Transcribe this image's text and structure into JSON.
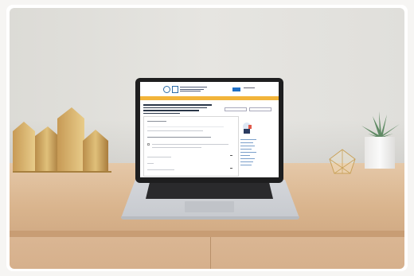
{
  "screen": {
    "site_title": "",
    "lang_button": "",
    "login_link": "",
    "banner_text": "",
    "page_title": "",
    "buttons": [
      "",
      ""
    ]
  },
  "colors": {
    "accent_blue": "#1f6fc6",
    "banner_yellow": "#f2b43a",
    "wall": "#e2e1dd",
    "desk_wood": "#d9b48d",
    "gold": "#c9a25a"
  }
}
